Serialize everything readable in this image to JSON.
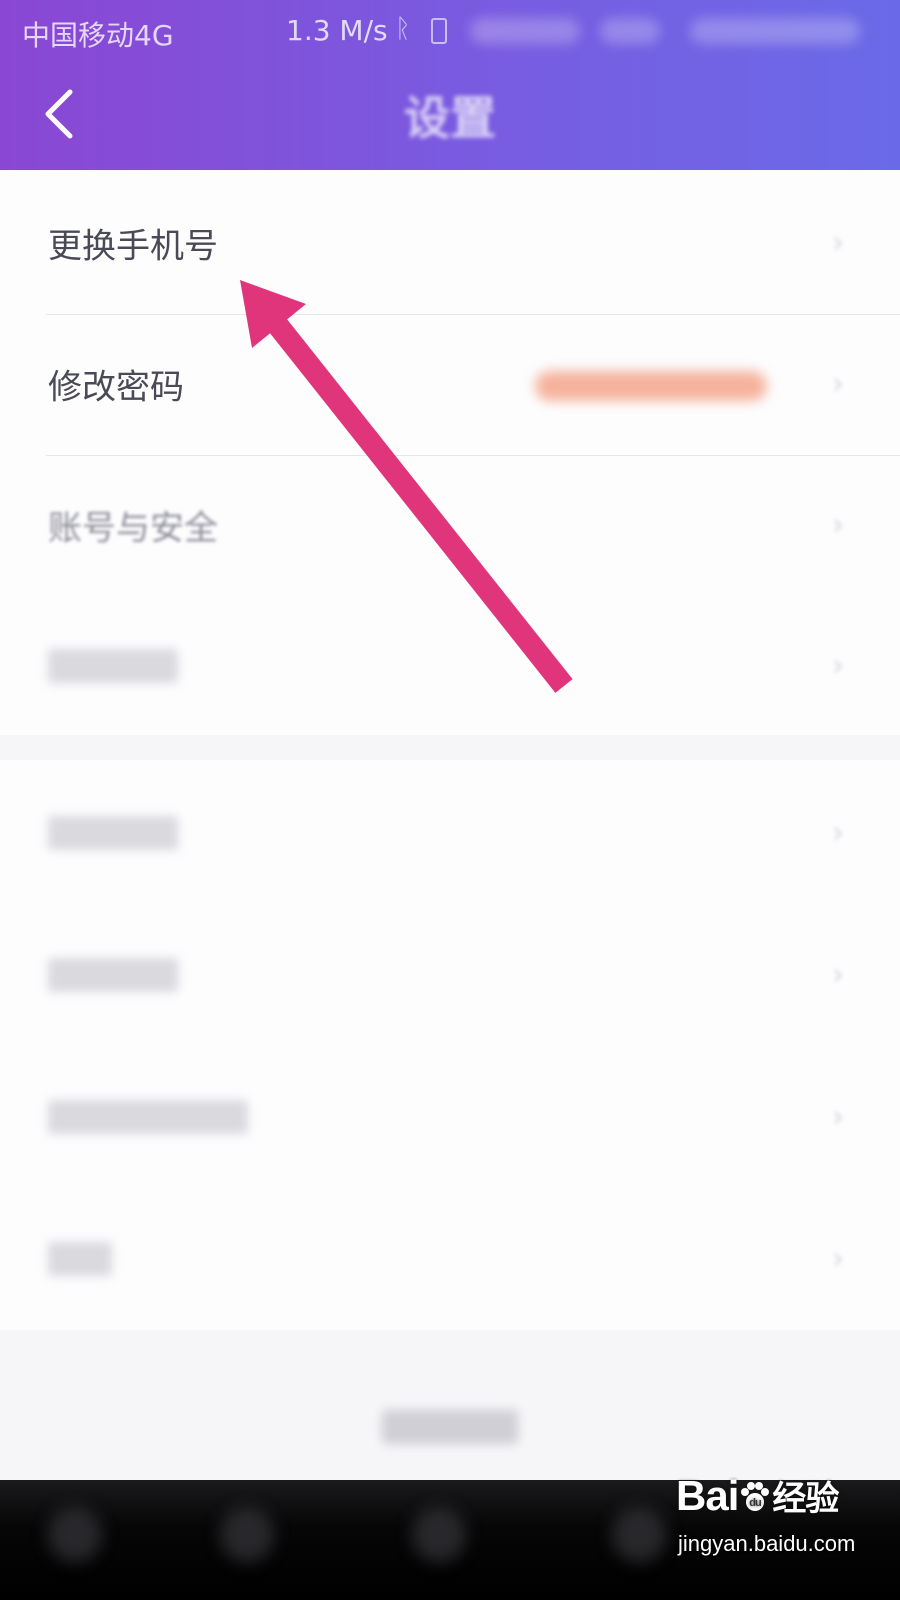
{
  "status_bar": {
    "carrier": "中国移动4G",
    "speed": "1.3 M/s",
    "icons": [
      "bluetooth-icon",
      "vibrate-icon"
    ]
  },
  "nav": {
    "back_icon": "chevron-left-icon",
    "title": "设置"
  },
  "settings": {
    "group1": [
      {
        "label": "更换手机号"
      },
      {
        "label": "修改密码"
      },
      {
        "label": "账号与安全"
      },
      {
        "label": ""
      }
    ],
    "group2": [
      {
        "label": ""
      },
      {
        "label": ""
      },
      {
        "label": ""
      },
      {
        "label": ""
      }
    ]
  },
  "logout_label": "",
  "annotation": {
    "color": "#e0357a"
  },
  "watermark": {
    "brand": "Bai",
    "brand_suffix": "经验",
    "url": "jingyan.baidu.com"
  },
  "colors": {
    "header_start": "#8a47d3",
    "header_end": "#6a6ae8",
    "row_bg": "#fdfdfe",
    "page_bg": "#f6f6f8"
  }
}
